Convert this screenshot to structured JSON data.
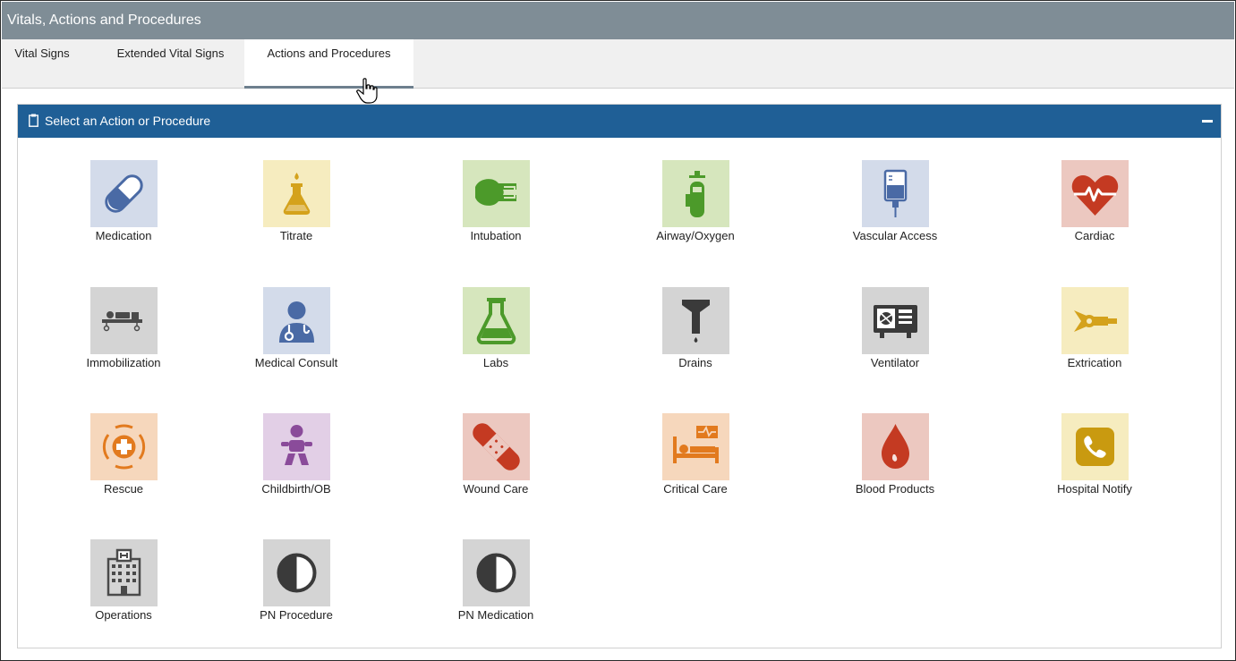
{
  "window": {
    "title": "Vitals, Actions and Procedures"
  },
  "tabs": [
    {
      "label": "Vital Signs",
      "active": false
    },
    {
      "label": "Extended Vital Signs",
      "active": false
    },
    {
      "label": "Actions and Procedures",
      "active": true
    }
  ],
  "panel": {
    "title": "Select an Action or Procedure",
    "header_color": "#1f5f96",
    "collapse_icon": "minus-icon"
  },
  "tiles": [
    {
      "label": "Medication",
      "icon": "capsule-icon",
      "bg": "#d3dbea",
      "fg": "#4a6aa5"
    },
    {
      "label": "Titrate",
      "icon": "flask-drop-icon",
      "bg": "#f6ecbf",
      "fg": "#d4a21c"
    },
    {
      "label": "Intubation",
      "icon": "intubation-icon",
      "bg": "#d6e6bd",
      "fg": "#4c9a2a"
    },
    {
      "label": "Airway/Oxygen",
      "icon": "oxygen-tank-icon",
      "bg": "#d6e6bd",
      "fg": "#4c9a2a"
    },
    {
      "label": "Vascular Access",
      "icon": "iv-bag-icon",
      "bg": "#d3dbea",
      "fg": "#4a6aa5"
    },
    {
      "label": "Cardiac",
      "icon": "heart-pulse-icon",
      "bg": "#ecc8c0",
      "fg": "#c43a22"
    },
    {
      "label": "Immobilization",
      "icon": "stretcher-icon",
      "bg": "#d4d4d4",
      "fg": "#4a4a4a"
    },
    {
      "label": "Medical Consult",
      "icon": "doctor-icon",
      "bg": "#d3dbea",
      "fg": "#4a6aa5"
    },
    {
      "label": "Labs",
      "icon": "flask-icon",
      "bg": "#d6e6bd",
      "fg": "#4c9a2a"
    },
    {
      "label": "Drains",
      "icon": "funnel-icon",
      "bg": "#d4d4d4",
      "fg": "#3a3a3a"
    },
    {
      "label": "Ventilator",
      "icon": "ventilator-icon",
      "bg": "#d4d4d4",
      "fg": "#3a3a3a"
    },
    {
      "label": "Extrication",
      "icon": "jaws-of-life-icon",
      "bg": "#f6ecbf",
      "fg": "#d4a21c"
    },
    {
      "label": "Rescue",
      "icon": "rescue-cross-icon",
      "bg": "#f6d7bc",
      "fg": "#e27a1e"
    },
    {
      "label": "Childbirth/OB",
      "icon": "baby-icon",
      "bg": "#e2cfe6",
      "fg": "#8a4b9a"
    },
    {
      "label": "Wound Care",
      "icon": "bandage-icon",
      "bg": "#ecc8c0",
      "fg": "#c43a22"
    },
    {
      "label": "Critical Care",
      "icon": "hospital-bed-icon",
      "bg": "#f6d7bc",
      "fg": "#e27a1e"
    },
    {
      "label": "Blood Products",
      "icon": "blood-drop-icon",
      "bg": "#ecc8c0",
      "fg": "#c43a22"
    },
    {
      "label": "Hospital Notify",
      "icon": "phone-icon",
      "bg": "#f6ecbf",
      "fg": "#c99a10"
    },
    {
      "label": "Operations",
      "icon": "hospital-building-icon",
      "bg": "#d4d4d4",
      "fg": "#4a4a4a"
    },
    {
      "label": "PN Procedure",
      "icon": "half-circle-icon",
      "bg": "#d4d4d4",
      "fg": "#3a3a3a"
    },
    {
      "label": "PN Medication",
      "icon": "half-circle-icon",
      "bg": "#d4d4d4",
      "fg": "#3a3a3a"
    }
  ]
}
